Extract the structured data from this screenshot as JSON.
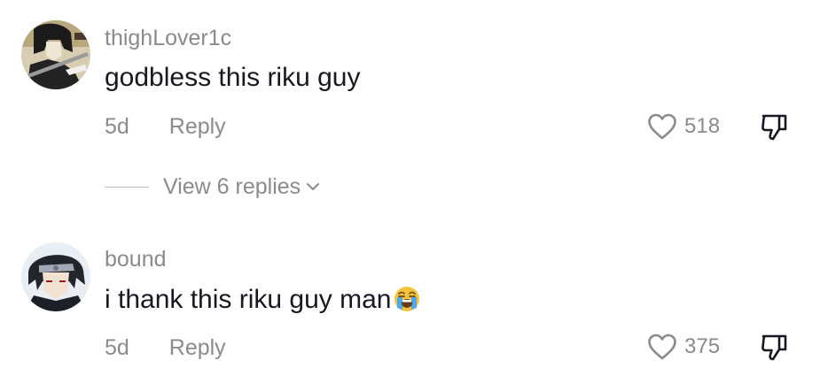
{
  "comments": [
    {
      "username": "thighLover1c",
      "text": "godbless this riku guy",
      "time": "5d",
      "reply_label": "Reply",
      "likes": "518",
      "view_replies": "View 6 replies"
    },
    {
      "username": "bound",
      "text": "i thank this riku guy man",
      "time": "5d",
      "reply_label": "Reply",
      "likes": "375"
    }
  ],
  "icons": {
    "like": "heart-outline-icon",
    "dislike": "thumbs-down-icon",
    "expand": "chevron-down-icon",
    "emoji": "loudly-crying-face-emoji"
  },
  "colors": {
    "text_primary": "#161823",
    "text_secondary": "#8a8a8f"
  }
}
